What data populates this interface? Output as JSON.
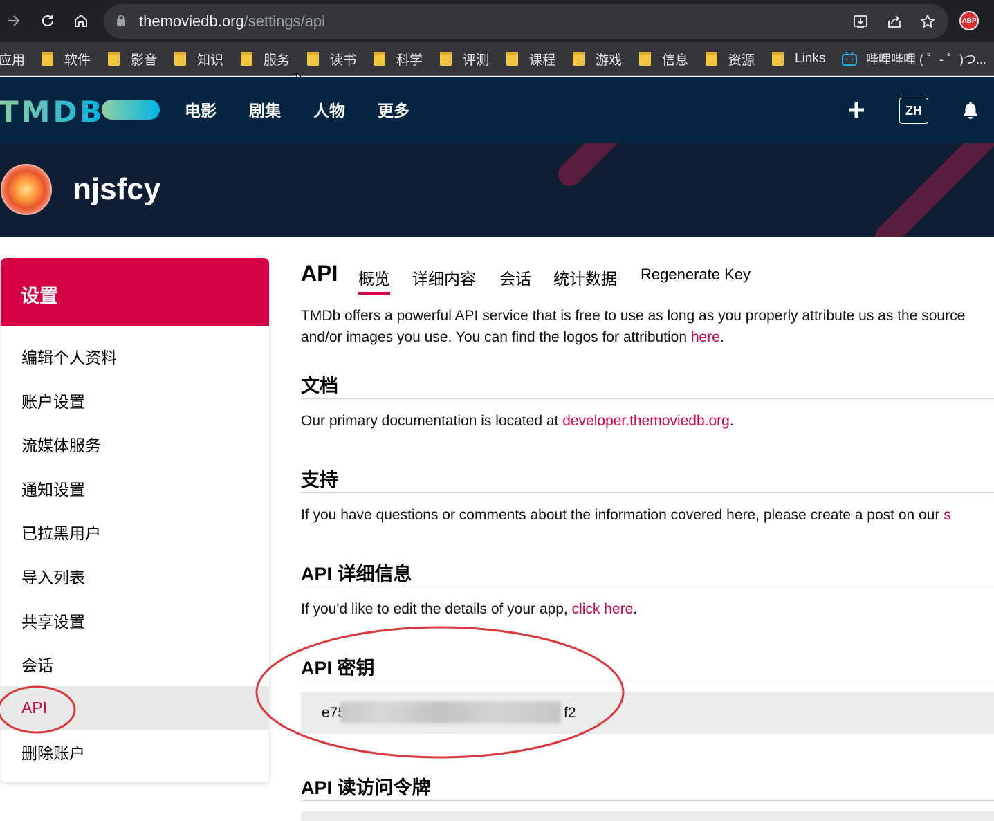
{
  "browser": {
    "url_domain": "themoviedb.org",
    "url_path": "/settings/api",
    "extension_label": "ABP",
    "bookmarks": [
      {
        "label": "应用",
        "type": "apps"
      },
      {
        "label": "软件",
        "type": "folder"
      },
      {
        "label": "影音",
        "type": "folder"
      },
      {
        "label": "知识",
        "type": "folder"
      },
      {
        "label": "服务",
        "type": "folder"
      },
      {
        "label": "读书",
        "type": "folder"
      },
      {
        "label": "科学",
        "type": "folder"
      },
      {
        "label": "评测",
        "type": "folder"
      },
      {
        "label": "课程",
        "type": "folder"
      },
      {
        "label": "游戏",
        "type": "folder"
      },
      {
        "label": "信息",
        "type": "folder"
      },
      {
        "label": "资源",
        "type": "folder"
      },
      {
        "label": "Links",
        "type": "folder"
      },
      {
        "label": "哔哩哔哩 ( ゜- ゜)つ...",
        "type": "bilibili"
      }
    ]
  },
  "header": {
    "logo": "TMDB",
    "nav": [
      "电影",
      "剧集",
      "人物",
      "更多"
    ],
    "language": "ZH",
    "icons": [
      "plus-icon",
      "bell-icon"
    ]
  },
  "profile": {
    "username": "njsfcy"
  },
  "sidebar": {
    "title": "设置",
    "items": [
      {
        "label": "编辑个人资料",
        "active": false
      },
      {
        "label": "账户设置",
        "active": false
      },
      {
        "label": "流媒体服务",
        "active": false
      },
      {
        "label": "通知设置",
        "active": false
      },
      {
        "label": "已拉黑用户",
        "active": false
      },
      {
        "label": "导入列表",
        "active": false
      },
      {
        "label": "共享设置",
        "active": false
      },
      {
        "label": "会话",
        "active": false
      },
      {
        "label": "API",
        "active": true
      },
      {
        "label": "删除账户",
        "active": false
      }
    ]
  },
  "main": {
    "title": "API",
    "tabs": [
      {
        "label": "概览",
        "active": true
      },
      {
        "label": "详细内容",
        "active": false
      },
      {
        "label": "会话",
        "active": false
      },
      {
        "label": "统计数据",
        "active": false
      },
      {
        "label": "Regenerate Key",
        "active": false
      }
    ],
    "intro_line1": "TMDb offers a powerful API service that is free to use as long as you properly attribute us as the source",
    "intro_line2": "and/or images you use. You can find the logos for attribution ",
    "intro_link": "here",
    "intro_end": ".",
    "sections": {
      "docs": {
        "heading": "文档",
        "text": "Our primary documentation is located at ",
        "link": "developer.themoviedb.org",
        "end": "."
      },
      "support": {
        "heading": "支持",
        "text": "If you have questions or comments about the information covered here, please create a post on our ",
        "link": "s"
      },
      "details": {
        "heading": "API 详细信息",
        "text": "If you'd like to edit the details of your app, ",
        "link": "click here",
        "end": "."
      },
      "key": {
        "heading": "API 密钥",
        "value_start": "e75",
        "value_end": "f2"
      },
      "token": {
        "heading": "API 读访问令牌"
      }
    }
  },
  "colors": {
    "tmdb_navy": "#032541",
    "accent_red": "#d40242",
    "annotation_red": "#d9393b"
  }
}
